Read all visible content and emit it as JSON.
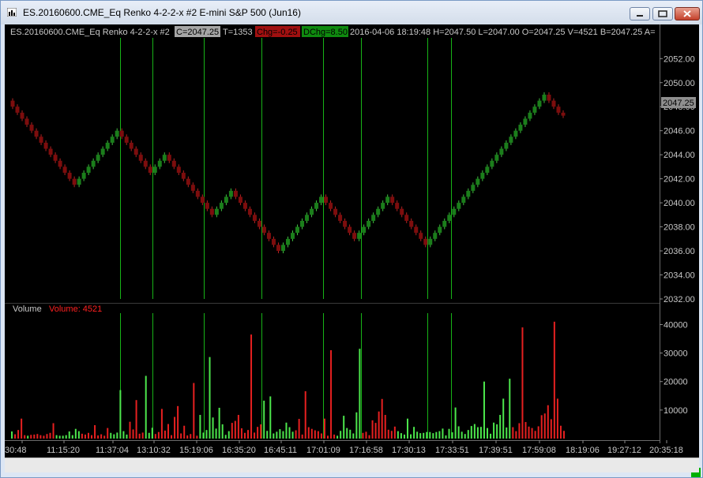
{
  "window": {
    "title": "ES.20160600.CME_Eq  Renko 4-2-2-x  #2  E-mini S&P 500 (Jun16)",
    "icons": [
      "chart-app-icon",
      "minimize-icon",
      "maximize-icon",
      "close-icon"
    ]
  },
  "header": {
    "prefix": "ES.20160600.CME_Eq  Renko 4-2-2-x  #2",
    "close_label": "C=2047.25",
    "ticks": "T=1353",
    "chg_label": "Chg=-0.25",
    "dchg_label": "DChg=8.50",
    "info": "2016-04-06 18:19:48 H=2047.50 L=2047.00 O=2047.25 V=4521 B=2047.25 A="
  },
  "price_tag": "2047.25",
  "volume_panel": {
    "label": "Volume",
    "value_label": "Volume: 4521"
  },
  "colors": {
    "up": "#1f8a1f",
    "down": "#8b0a0a",
    "vol_up": "#4ce64c",
    "vol_down": "#e62020",
    "session": "#17b317",
    "up_body": "#1b7e1b",
    "down_body": "#7d0d0d"
  },
  "chart_data": [
    {
      "type": "renko-candlestick",
      "brick_size": 0.5,
      "y_ticks": [
        2032,
        2034,
        2036,
        2038,
        2040,
        2042,
        2044,
        2046,
        2048,
        2050,
        2052
      ],
      "y_tick_labels": [
        "2032.00",
        "2034.00",
        "2036.00",
        "2038.00",
        "2040.00",
        "2042.00",
        "2044.00",
        "2046.00",
        "2048.00",
        "2050.00",
        "2052.00"
      ],
      "ylim": [
        2032,
        2053.2
      ],
      "legs": [
        {
          "from": 2048.5,
          "to": 2041.5,
          "dir": "down"
        },
        {
          "from": 2041.5,
          "to": 2046.0,
          "dir": "up"
        },
        {
          "from": 2046.0,
          "to": 2042.5,
          "dir": "down"
        },
        {
          "from": 2042.5,
          "to": 2044.0,
          "dir": "up"
        },
        {
          "from": 2044.0,
          "to": 2039.0,
          "dir": "down"
        },
        {
          "from": 2039.0,
          "to": 2041.0,
          "dir": "up"
        },
        {
          "from": 2041.0,
          "to": 2036.0,
          "dir": "down"
        },
        {
          "from": 2036.0,
          "to": 2040.5,
          "dir": "up"
        },
        {
          "from": 2040.5,
          "to": 2037.0,
          "dir": "down"
        },
        {
          "from": 2037.0,
          "to": 2040.5,
          "dir": "up"
        },
        {
          "from": 2040.5,
          "to": 2036.5,
          "dir": "down"
        },
        {
          "from": 2036.5,
          "to": 2049.0,
          "dir": "up"
        },
        {
          "from": 2049.0,
          "to": 2047.25,
          "dir": "down"
        }
      ],
      "last_price": 2047.25
    },
    {
      "type": "bar",
      "title": "Volume",
      "y_ticks": [
        10000,
        20000,
        30000,
        40000
      ],
      "y_tick_labels": [
        "10000",
        "20000",
        "30000",
        "40000"
      ],
      "ylim": [
        0,
        44000
      ],
      "values": [
        2500,
        1500,
        3000,
        7000,
        1200,
        1000,
        1300,
        1400,
        1600,
        1200,
        1000,
        1600,
        2000,
        5400,
        1200,
        1000,
        1000,
        1200,
        2500,
        1200,
        3400,
        2600,
        1700,
        1400,
        2000,
        1200,
        4700,
        1100,
        1500,
        1000,
        3700,
        2000,
        1500,
        2100,
        17000,
        2600,
        1400,
        5900,
        3200,
        13500,
        1700,
        2100,
        22000,
        2000,
        3800,
        1600,
        2300,
        10400,
        2800,
        5100,
        1200,
        7600,
        11400,
        1800,
        4500,
        1100,
        1600,
        19500,
        1000,
        8300,
        2100,
        3000,
        28600,
        7400,
        3500,
        10800,
        5000,
        1300,
        2600,
        5500,
        6200,
        8300,
        3600,
        2000,
        3000,
        36500,
        2100,
        4100,
        5000,
        13300,
        2700,
        14800,
        1800,
        2400,
        3300,
        2600,
        5600,
        4000,
        2400,
        2900,
        6900,
        1400,
        16600,
        4000,
        3400,
        2900,
        2600,
        1800,
        7000,
        1000,
        31000,
        1400,
        1000,
        2700,
        8000,
        3700,
        3100,
        1800,
        9200,
        31500,
        2000,
        2400,
        1200,
        6400,
        5500,
        9500,
        13900,
        8300,
        3100,
        2700,
        4200,
        2600,
        1900,
        1400,
        7000,
        1500,
        4100,
        2400,
        1900,
        2000,
        2300,
        2300,
        1900,
        2300,
        2600,
        3500,
        1100,
        3400,
        2200,
        10900,
        4300,
        2400,
        1600,
        3000,
        4400,
        5100,
        4000,
        4100,
        20000,
        3700,
        1700,
        5600,
        5000,
        8300,
        14000,
        3900,
        21000,
        4000,
        2600,
        5400,
        39000,
        5800,
        4200,
        3700,
        2700,
        4300,
        8200,
        8800,
        11700,
        6800,
        41000,
        14000,
        4500,
        2700
      ],
      "up_flags": "GRRRRGRRRRRRRRGGGGGGGGRRRRRRRRRGGGGGGRRRRRGGGRRRRRRRRRRRRRRGGGGGGGGGGRRRRRRRRRRGGGGGGGGGGRRRRRRRRRRRRRGGGGGGGGRRRRRRRRRRRGGGGGGGGGGGGGGGGGGGGGGGGGGGGGGGGGGGGRRR"
    }
  ],
  "x_axis": {
    "labels": [
      "30:48",
      "11:15:20",
      "11:37:04",
      "13:10:32",
      "15:19:06",
      "16:35:20",
      "16:45:11",
      "17:01:09",
      "17:16:58",
      "17:30:13",
      "17:33:51",
      "17:39:51",
      "17:59:08",
      "18:19:06",
      "19:27:12",
      "20:35:18"
    ]
  }
}
